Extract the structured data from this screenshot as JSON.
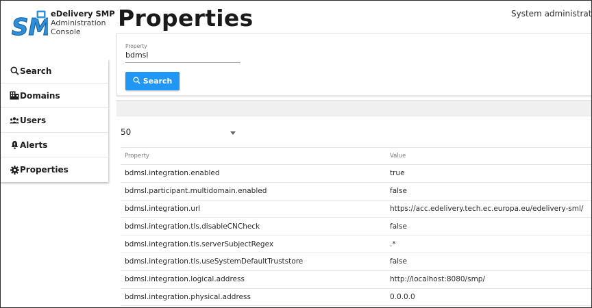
{
  "app": {
    "logo_text": "SMP",
    "title_line1": "eDelivery SMP",
    "title_line2": "Administration",
    "title_line3": "Console"
  },
  "sidebar": {
    "items": [
      {
        "label": "Search",
        "icon": "search-icon"
      },
      {
        "label": "Domains",
        "icon": "domains-icon"
      },
      {
        "label": "Users",
        "icon": "users-icon"
      },
      {
        "label": "Alerts",
        "icon": "alerts-icon"
      },
      {
        "label": "Properties",
        "icon": "gear-icon"
      }
    ]
  },
  "header": {
    "page_title": "Properties",
    "user": "System administrato"
  },
  "search": {
    "property_label": "Property",
    "property_value": "bdmsl",
    "button_label": "Search",
    "button_color": "#2196f3"
  },
  "paging": {
    "page_size": "50"
  },
  "table": {
    "headers": [
      "Property",
      "Value"
    ],
    "rows": [
      [
        "bdmsl.integration.enabled",
        "true"
      ],
      [
        "bdmsl.participant.multidomain.enabled",
        "false"
      ],
      [
        "bdmsl.integration.url",
        "https://acc.edelivery.tech.ec.europa.eu/edelivery-sml/"
      ],
      [
        "bdmsl.integration.tls.disableCNCheck",
        "false"
      ],
      [
        "bdmsl.integration.tls.serverSubjectRegex",
        ".*"
      ],
      [
        "bdmsl.integration.tls.useSystemDefaultTruststore",
        "false"
      ],
      [
        "bdmsl.integration.logical.address",
        "http://localhost:8080/smp/"
      ],
      [
        "bdmsl.integration.physical.address",
        "0.0.0.0"
      ]
    ]
  }
}
